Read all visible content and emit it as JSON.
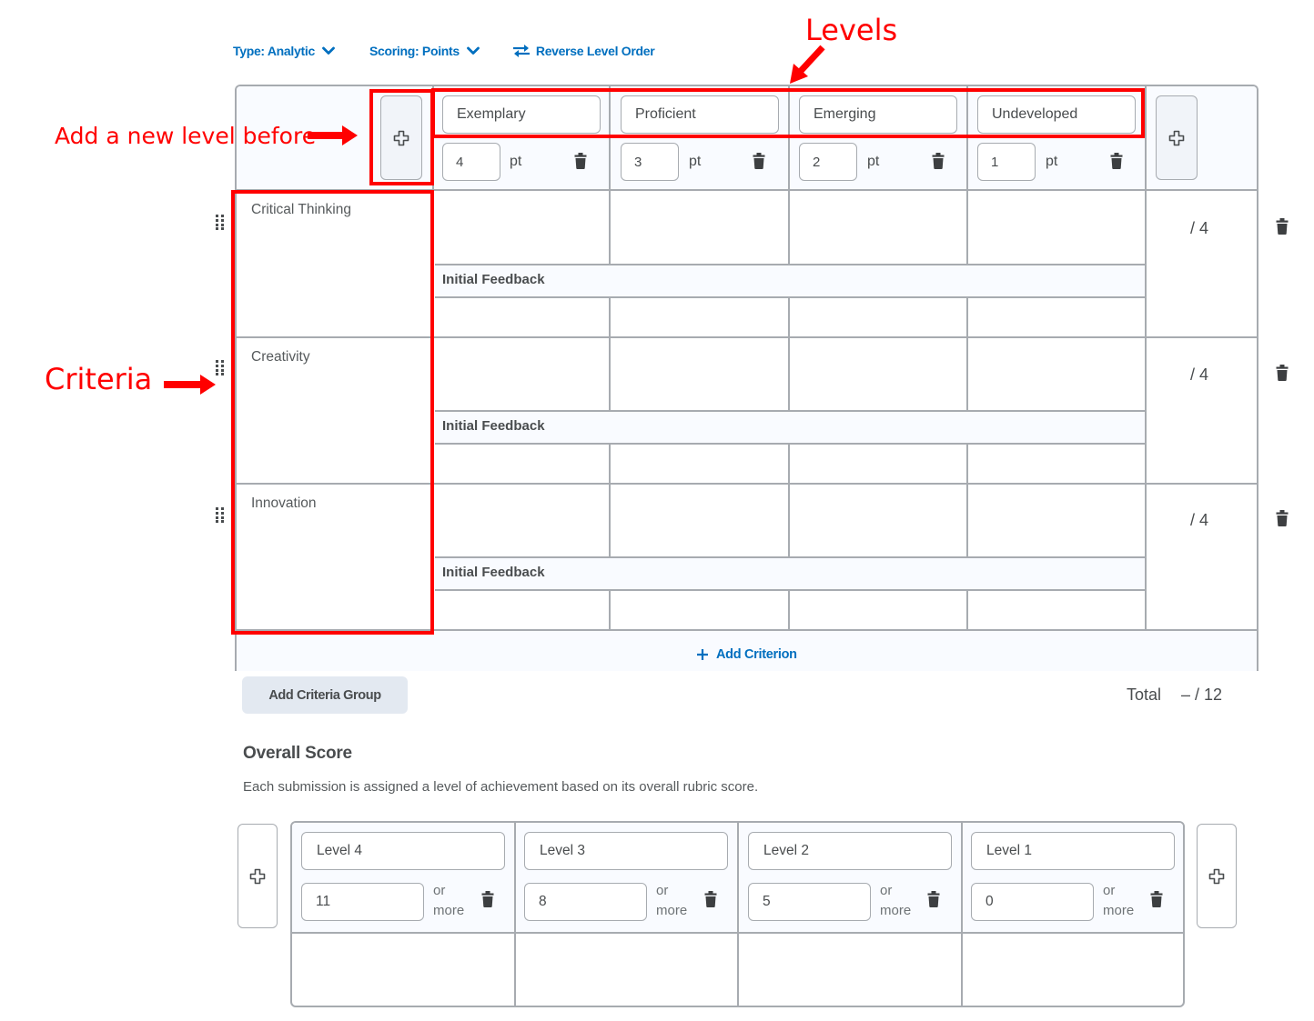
{
  "toolbar": {
    "type_label": "Type: Analytic",
    "scoring_label": "Scoring: Points",
    "reverse_label": "Reverse Level Order"
  },
  "levels": [
    {
      "name": "Exemplary",
      "points": "4",
      "unit": "pt"
    },
    {
      "name": "Proficient",
      "points": "3",
      "unit": "pt"
    },
    {
      "name": "Emerging",
      "points": "2",
      "unit": "pt"
    },
    {
      "name": "Undeveloped",
      "points": "1",
      "unit": "pt"
    }
  ],
  "criteria": [
    {
      "name": "Critical Thinking",
      "feedback_label": "Initial Feedback",
      "score": "/ 4"
    },
    {
      "name": "Creativity",
      "feedback_label": "Initial Feedback",
      "score": "/ 4"
    },
    {
      "name": "Innovation",
      "feedback_label": "Initial Feedback",
      "score": "/ 4"
    }
  ],
  "add_criterion_label": "Add Criterion",
  "add_criteria_group_label": "Add Criteria Group",
  "total": {
    "label": "Total",
    "value": "– / 12"
  },
  "overall_score": {
    "title": "Overall Score",
    "description": "Each submission is assigned a level of achievement based on its overall rubric score.",
    "levels": [
      {
        "name": "Level 4",
        "min": "11",
        "suffix_line1": "or",
        "suffix_line2": "more"
      },
      {
        "name": "Level 3",
        "min": "8",
        "suffix_line1": "or",
        "suffix_line2": "more"
      },
      {
        "name": "Level 2",
        "min": "5",
        "suffix_line1": "or",
        "suffix_line2": "more"
      },
      {
        "name": "Level 1",
        "min": "0",
        "suffix_line1": "or",
        "suffix_line2": "more"
      }
    ]
  },
  "annotations": {
    "levels": "Levels",
    "add_level_before": "Add a new level before",
    "criteria": "Criteria"
  },
  "colors": {
    "link_blue": "#006fbf",
    "annotation_red": "#ff0000",
    "border_gray": "#a7abb0",
    "header_bg": "#f9fbff"
  }
}
